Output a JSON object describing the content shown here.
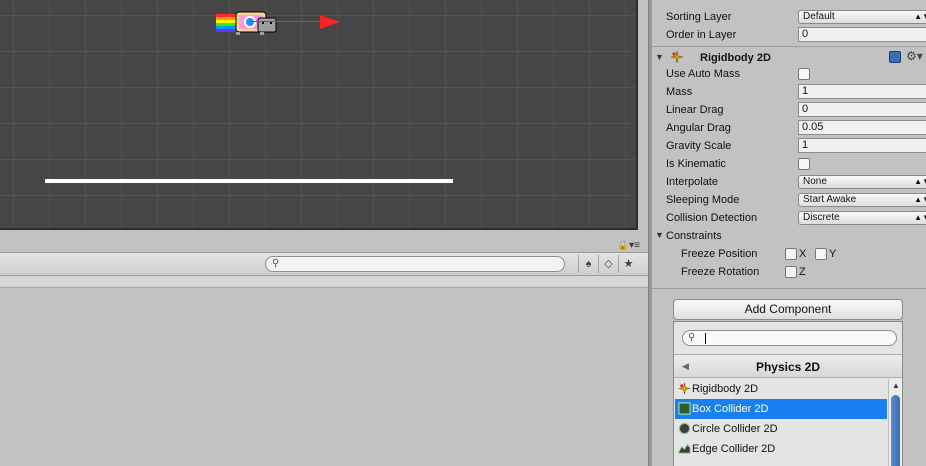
{
  "inspector": {
    "sorting_layer": {
      "label": "Sorting Layer",
      "value": "Default"
    },
    "order_in_layer": {
      "label": "Order in Layer",
      "value": "0"
    },
    "rigidbody": {
      "title": "Rigidbody 2D",
      "use_auto_mass": {
        "label": "Use Auto Mass",
        "checked": false
      },
      "mass": {
        "label": "Mass",
        "value": "1"
      },
      "linear_drag": {
        "label": "Linear Drag",
        "value": "0"
      },
      "angular_drag": {
        "label": "Angular Drag",
        "value": "0.05"
      },
      "gravity_scale": {
        "label": "Gravity Scale",
        "value": "1"
      },
      "is_kinematic": {
        "label": "Is Kinematic",
        "checked": false
      },
      "interpolate": {
        "label": "Interpolate",
        "value": "None"
      },
      "sleeping_mode": {
        "label": "Sleeping Mode",
        "value": "Start Awake"
      },
      "collision_detection": {
        "label": "Collision Detection",
        "value": "Discrete"
      },
      "constraints": {
        "label": "Constraints",
        "freeze_position": {
          "label": "Freeze Position",
          "x": "X",
          "y": "Y"
        },
        "freeze_rotation": {
          "label": "Freeze Rotation",
          "z": "Z"
        }
      }
    },
    "add_component_label": "Add Component"
  },
  "popup": {
    "title": "Physics 2D",
    "items": [
      {
        "label": "Rigidbody 2D",
        "icon": "rigidbody-icon"
      },
      {
        "label": "Box Collider 2D",
        "icon": "box-collider-icon",
        "selected": true
      },
      {
        "label": "Circle Collider 2D",
        "icon": "circle-collider-icon"
      },
      {
        "label": "Edge Collider 2D",
        "icon": "edge-collider-icon"
      }
    ]
  },
  "colors": {
    "selection": "#1a7ff0",
    "scene_bg": "#464646",
    "arrow": "#ff2020"
  }
}
